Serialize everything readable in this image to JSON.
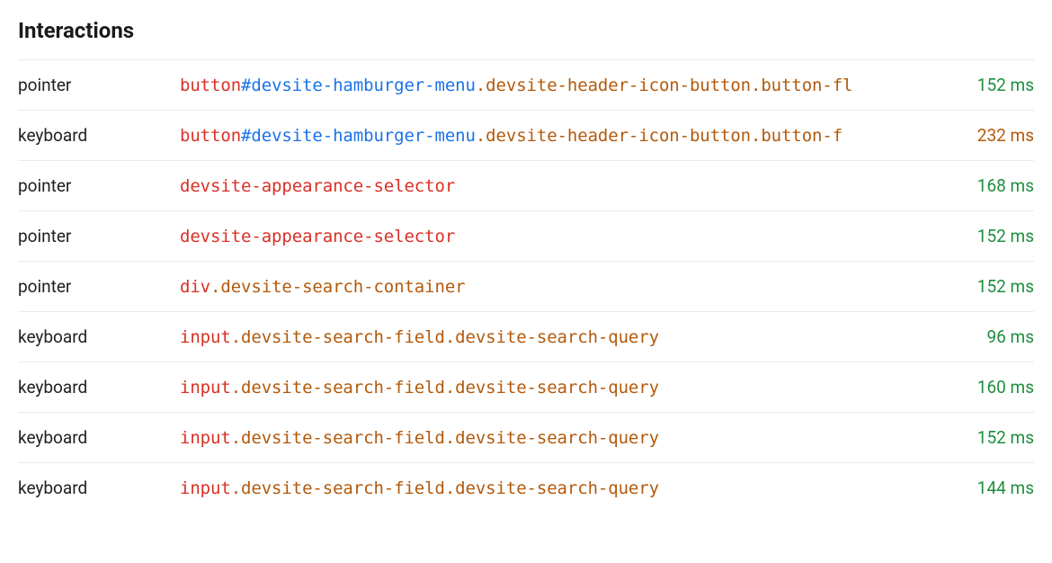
{
  "title": "Interactions",
  "duration_unit": "ms",
  "rows": [
    {
      "type": "pointer",
      "selector": [
        {
          "kind": "tag",
          "text": "button"
        },
        {
          "kind": "id",
          "text": "#devsite-hamburger-menu"
        },
        {
          "kind": "class",
          "text": ".devsite-header-icon-button.button-fl"
        }
      ],
      "duration": 152,
      "duration_level": "ok"
    },
    {
      "type": "keyboard",
      "selector": [
        {
          "kind": "tag",
          "text": "button"
        },
        {
          "kind": "id",
          "text": "#devsite-hamburger-menu"
        },
        {
          "kind": "class",
          "text": ".devsite-header-icon-button.button-f"
        }
      ],
      "duration": 232,
      "duration_level": "warn"
    },
    {
      "type": "pointer",
      "selector": [
        {
          "kind": "tag",
          "text": "devsite-appearance-selector"
        }
      ],
      "duration": 168,
      "duration_level": "ok"
    },
    {
      "type": "pointer",
      "selector": [
        {
          "kind": "tag",
          "text": "devsite-appearance-selector"
        }
      ],
      "duration": 152,
      "duration_level": "ok"
    },
    {
      "type": "pointer",
      "selector": [
        {
          "kind": "tag",
          "text": "div"
        },
        {
          "kind": "class",
          "text": ".devsite-search-container"
        }
      ],
      "duration": 152,
      "duration_level": "ok"
    },
    {
      "type": "keyboard",
      "selector": [
        {
          "kind": "tag",
          "text": "input"
        },
        {
          "kind": "class",
          "text": ".devsite-search-field.devsite-search-query"
        }
      ],
      "duration": 96,
      "duration_level": "ok"
    },
    {
      "type": "keyboard",
      "selector": [
        {
          "kind": "tag",
          "text": "input"
        },
        {
          "kind": "class",
          "text": ".devsite-search-field.devsite-search-query"
        }
      ],
      "duration": 160,
      "duration_level": "ok"
    },
    {
      "type": "keyboard",
      "selector": [
        {
          "kind": "tag",
          "text": "input"
        },
        {
          "kind": "class",
          "text": ".devsite-search-field.devsite-search-query"
        }
      ],
      "duration": 152,
      "duration_level": "ok"
    },
    {
      "type": "keyboard",
      "selector": [
        {
          "kind": "tag",
          "text": "input"
        },
        {
          "kind": "class",
          "text": ".devsite-search-field.devsite-search-query"
        }
      ],
      "duration": 144,
      "duration_level": "ok"
    }
  ]
}
